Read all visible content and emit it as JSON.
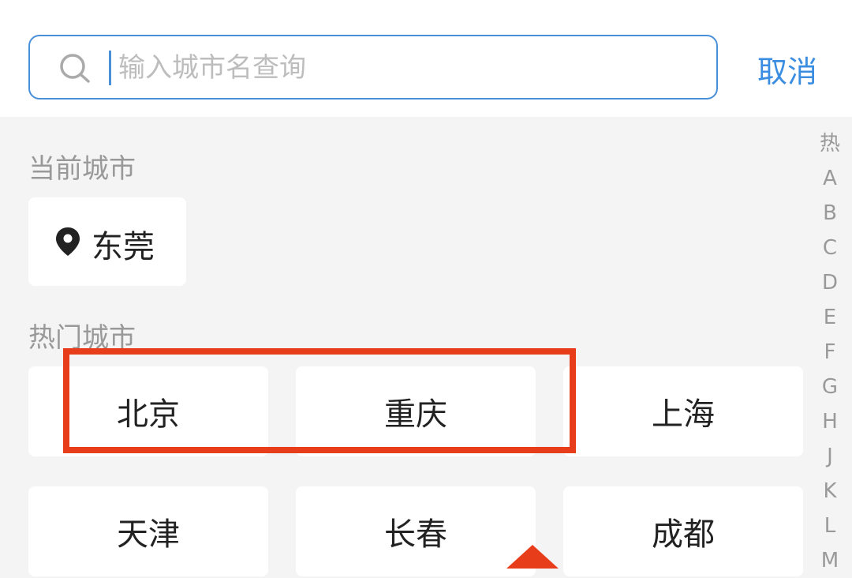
{
  "search": {
    "placeholder": "输入城市名查询",
    "cancel_label": "取消"
  },
  "current": {
    "title": "当前城市",
    "city": "东莞",
    "icon": "location-pin-icon"
  },
  "hot": {
    "title": "热门城市",
    "cities": [
      "北京",
      "重庆",
      "上海",
      "天津",
      "长春",
      "成都"
    ]
  },
  "index": [
    "热",
    "A",
    "B",
    "C",
    "D",
    "E",
    "F",
    "G",
    "H",
    "J",
    "K",
    "L",
    "M"
  ],
  "colors": {
    "accent": "#3a8de0",
    "highlight": "#e83d1a",
    "background": "#f4f4f4"
  }
}
